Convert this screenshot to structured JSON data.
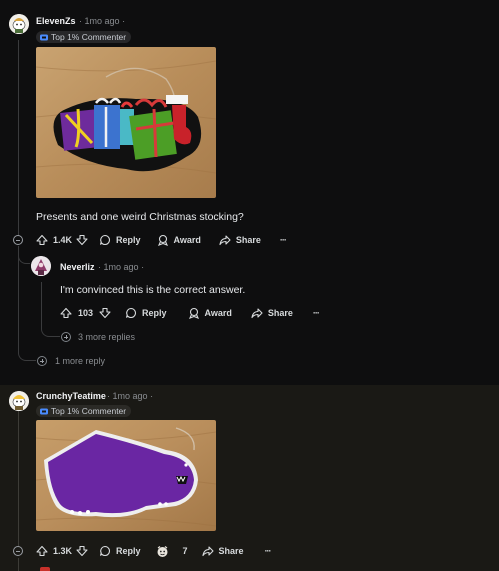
{
  "comments": [
    {
      "author": "ElevenZs",
      "time": "1mo ago",
      "dot": "·",
      "badge": "Top 1% Commenter",
      "image_alt": "Painted gift boxes and a Christmas stocking on a wooden surface",
      "text": "Presents and one weird Christmas stocking?",
      "score": "1.4K",
      "reply_label": "Reply",
      "award_label": "Award",
      "share_label": "Share",
      "more_label": "···",
      "replies": [
        {
          "author": "Neverliz",
          "time": "1mo ago",
          "dot": "·",
          "text": "I'm convinced this is the correct answer.",
          "score": "103",
          "reply_label": "Reply",
          "award_label": "Award",
          "share_label": "Share",
          "more_label": "···",
          "more_replies": "3 more replies"
        }
      ],
      "more_reply": "1 more reply"
    },
    {
      "author": "CrunchyTeatime",
      "time": "1mo ago",
      "dot": "·",
      "badge": "Top 1% Commenter",
      "image_alt": "Purple painted dinosaur-like creature on a wooden surface",
      "score": "1.3K",
      "reply_label": "Reply",
      "award_count": "7",
      "share_label": "Share",
      "more_label": "···"
    }
  ],
  "colors": {
    "background": "#0e0e0f",
    "highlighted_background": "#1a1915",
    "text": "#d7dadc",
    "muted": "#8a8d91",
    "badge_icon": "#4a8cff"
  }
}
